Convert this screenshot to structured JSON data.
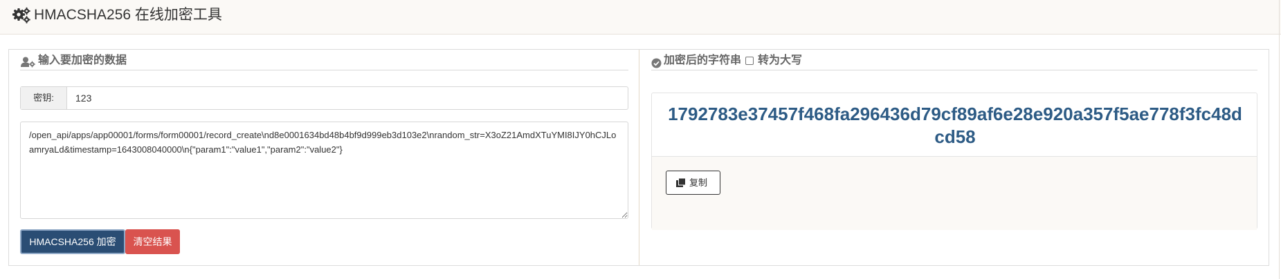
{
  "header": {
    "title": "HMACSHA256 在线加密工具"
  },
  "input_section": {
    "title": "输入要加密的数据",
    "key_label": "密钥:",
    "key_value": "123",
    "data_value": "/open_api/apps/app00001/forms/form00001/record_create\\nd8e0001634bd48b4bf9d999eb3d103e2\\nrandom_str=X3oZ21AmdXTuYMI8IJY0hCJLoamryaLd&timestamp=1643008040000\\n{\"param1\":\"value1\",\"param2\":\"value2\"}",
    "encrypt_button": "HMACSHA256 加密",
    "clear_button": "清空结果"
  },
  "result_section": {
    "title": "加密后的字符串",
    "uppercase_label": "转为大写",
    "uppercase_checked": false,
    "hash": "1792783e37457f468fa296436d79cf89af6e28e920a357f5ae778f3fc48dcd58",
    "copy_button": "复制"
  },
  "colors": {
    "primary": "#2a4d74",
    "danger": "#d9534f",
    "hash_text": "#2d5b85",
    "header_bg": "#fbf9f6"
  }
}
